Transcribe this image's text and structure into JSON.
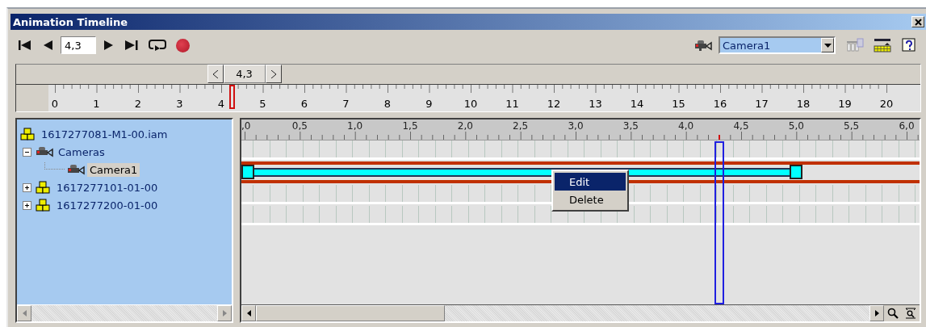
{
  "window": {
    "title": "Animation Timeline"
  },
  "toolbar": {
    "time_field": {
      "value": "4,3"
    },
    "record": {
      "on": true
    },
    "camera_select": {
      "value": "Camera1"
    }
  },
  "time_ruler": {
    "current": "4,3",
    "level": 0.215,
    "labels": [
      "0",
      "1",
      "2",
      "3",
      "4",
      "5",
      "6",
      "7",
      "8",
      "9",
      "10",
      "11",
      "12",
      "13",
      "14",
      "15",
      "16",
      "17",
      "18",
      "19",
      "20"
    ]
  },
  "tree": [
    {
      "label": "1617277081-M1-00.iam",
      "kind": "assembly",
      "selected": false,
      "children": [
        {
          "label": "Cameras",
          "kind": "camera",
          "selected": false,
          "expanded": true,
          "children": [
            {
              "label": "Camera1",
              "kind": "camera",
              "selected": true
            }
          ]
        },
        {
          "label": "1617277101-01-00",
          "kind": "assembly",
          "selected": false,
          "expanded": false
        },
        {
          "label": "1617277200-01-00",
          "kind": "assembly",
          "selected": false,
          "expanded": false
        }
      ]
    }
  ],
  "timeline": {
    "labels": [
      ",0",
      "0,5",
      "1,0",
      "1,5",
      "2,0",
      "2,5",
      "3,0",
      "3,5",
      "4,0",
      "4,5",
      "5,0",
      "5,5",
      "6,0"
    ],
    "cursor": {
      "level": 0.717
    },
    "tracks": [
      {
        "kind": "empty"
      },
      {
        "kind": "action",
        "level": 0.833
      },
      {
        "kind": "empty"
      },
      {
        "kind": "empty"
      }
    ]
  },
  "context_menu": [
    {
      "label": "Edit",
      "selected": true
    },
    {
      "label": "Delete",
      "selected": false
    }
  ]
}
